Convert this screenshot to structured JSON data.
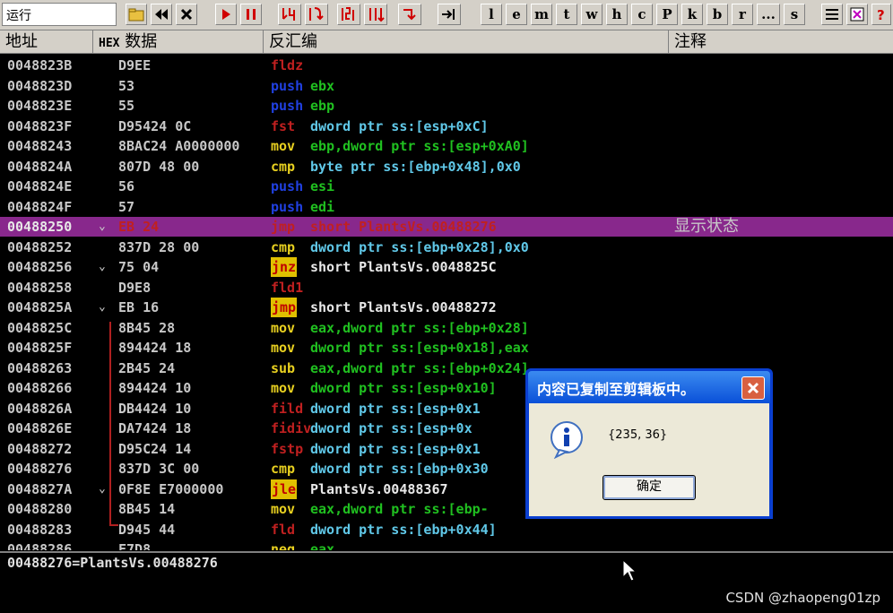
{
  "toolbar": {
    "status": "运行",
    "letters": [
      "l",
      "e",
      "m",
      "t",
      "w",
      "h",
      "c",
      "P",
      "k",
      "b",
      "r",
      "...",
      "s"
    ]
  },
  "columns": {
    "address": "地址",
    "hex_prefix": "HEX",
    "hex_suffix": "数据",
    "disasm": "反汇编",
    "comment": "注释"
  },
  "colors": {
    "highlight": "#88288c",
    "mnemonic_yellow": "#e8d020",
    "operand_green": "#20c020",
    "blue": "#2040e0",
    "red": "#c02020",
    "cyan": "#60c8e8",
    "gray": "#c8c8c8"
  },
  "rows": [
    {
      "addr": "0048823B",
      "hex": "D9EE",
      "mn": "fldz",
      "op": "",
      "comment": "",
      "mark": ""
    },
    {
      "addr": "0048823D",
      "hex": "53",
      "mn": "push",
      "op": "ebx",
      "comment": "",
      "mark": ""
    },
    {
      "addr": "0048823E",
      "hex": "55",
      "mn": "push",
      "op": "ebp",
      "comment": "",
      "mark": ""
    },
    {
      "addr": "0048823F",
      "hex": "D95424 0C",
      "mn": "fst",
      "op": "dword ptr ss:[esp+0xC]",
      "comment": "",
      "mark": ""
    },
    {
      "addr": "00488243",
      "hex": "8BAC24 A0000000",
      "mn": "mov",
      "op": "ebp,dword ptr ss:[esp+0xA0]",
      "comment": "",
      "mark": ""
    },
    {
      "addr": "0048824A",
      "hex": "807D 48 00",
      "mn": "cmp",
      "op": "byte ptr ss:[ebp+0x48],0x0",
      "comment": "",
      "mark": ""
    },
    {
      "addr": "0048824E",
      "hex": "56",
      "mn": "push",
      "op": "esi",
      "comment": "",
      "mark": ""
    },
    {
      "addr": "0048824F",
      "hex": "57",
      "mn": "push",
      "op": "edi",
      "comment": "",
      "mark": ""
    },
    {
      "addr": "00488250",
      "hex": "EB 24",
      "mn": "jmp",
      "op": "short PlantsVs.00488276",
      "comment": "显示状态",
      "mark": "⌄"
    },
    {
      "addr": "00488252",
      "hex": "837D 28 00",
      "mn": "cmp",
      "op": "dword ptr ss:[ebp+0x28],0x0",
      "comment": "",
      "mark": ""
    },
    {
      "addr": "00488256",
      "hex": "75 04",
      "mn": "jnz",
      "op": "short PlantsVs.0048825C",
      "comment": "",
      "mark": "⌄"
    },
    {
      "addr": "00488258",
      "hex": "D9E8",
      "mn": "fld1",
      "op": "",
      "comment": "",
      "mark": ""
    },
    {
      "addr": "0048825A",
      "hex": "EB 16",
      "mn": "jmp",
      "op": "short PlantsVs.00488272",
      "comment": "",
      "mark": "⌄"
    },
    {
      "addr": "0048825C",
      "hex": "8B45 28",
      "mn": "mov",
      "op": "eax,dword ptr ss:[ebp+0x28]",
      "comment": "",
      "mark": ""
    },
    {
      "addr": "0048825F",
      "hex": "894424 18",
      "mn": "mov",
      "op": "dword ptr ss:[esp+0x18],eax",
      "comment": "",
      "mark": ""
    },
    {
      "addr": "00488263",
      "hex": "2B45 24",
      "mn": "sub",
      "op": "eax,dword ptr ss:[ebp+0x24]",
      "comment": "",
      "mark": ""
    },
    {
      "addr": "00488266",
      "hex": "894424 10",
      "mn": "mov",
      "op": "dword ptr ss:[esp+0x10]",
      "comment": "",
      "mark": ""
    },
    {
      "addr": "0048826A",
      "hex": "DB4424 10",
      "mn": "fild",
      "op": "dword ptr ss:[esp+0x1",
      "comment": "",
      "mark": ""
    },
    {
      "addr": "0048826E",
      "hex": "DA7424 18",
      "mn": "fidiv",
      "op": "dword ptr ss:[esp+0x",
      "comment": "",
      "mark": ""
    },
    {
      "addr": "00488272",
      "hex": "D95C24 14",
      "mn": "fstp",
      "op": "dword ptr ss:[esp+0x1",
      "comment": "",
      "mark": ""
    },
    {
      "addr": "00488276",
      "hex": "837D 3C 00",
      "mn": "cmp",
      "op": "dword ptr ss:[ebp+0x30",
      "comment": "",
      "mark": ""
    },
    {
      "addr": "0048827A",
      "hex": "0F8E E7000000",
      "mn": "jle",
      "op": "PlantsVs.00488367",
      "comment": "",
      "mark": "⌄"
    },
    {
      "addr": "00488280",
      "hex": "8B45 14",
      "mn": "mov",
      "op": "eax,dword ptr ss:[ebp-",
      "comment": "",
      "mark": ""
    },
    {
      "addr": "00488283",
      "hex": "D945 44",
      "mn": "fld",
      "op": "dword ptr ss:[ebp+0x44]",
      "comment": "",
      "mark": ""
    },
    {
      "addr": "00488286",
      "hex": "F7D8",
      "mn": "neg",
      "op": "eax",
      "comment": "",
      "mark": ""
    }
  ],
  "info_line": "00488276=PlantsVs.00488276",
  "dialog": {
    "title": "内容已复制至剪辑板中。",
    "message": "{235, 36}",
    "ok_label": "确定",
    "icon": "info-icon"
  },
  "watermark": "CSDN @zhaopeng01zp"
}
